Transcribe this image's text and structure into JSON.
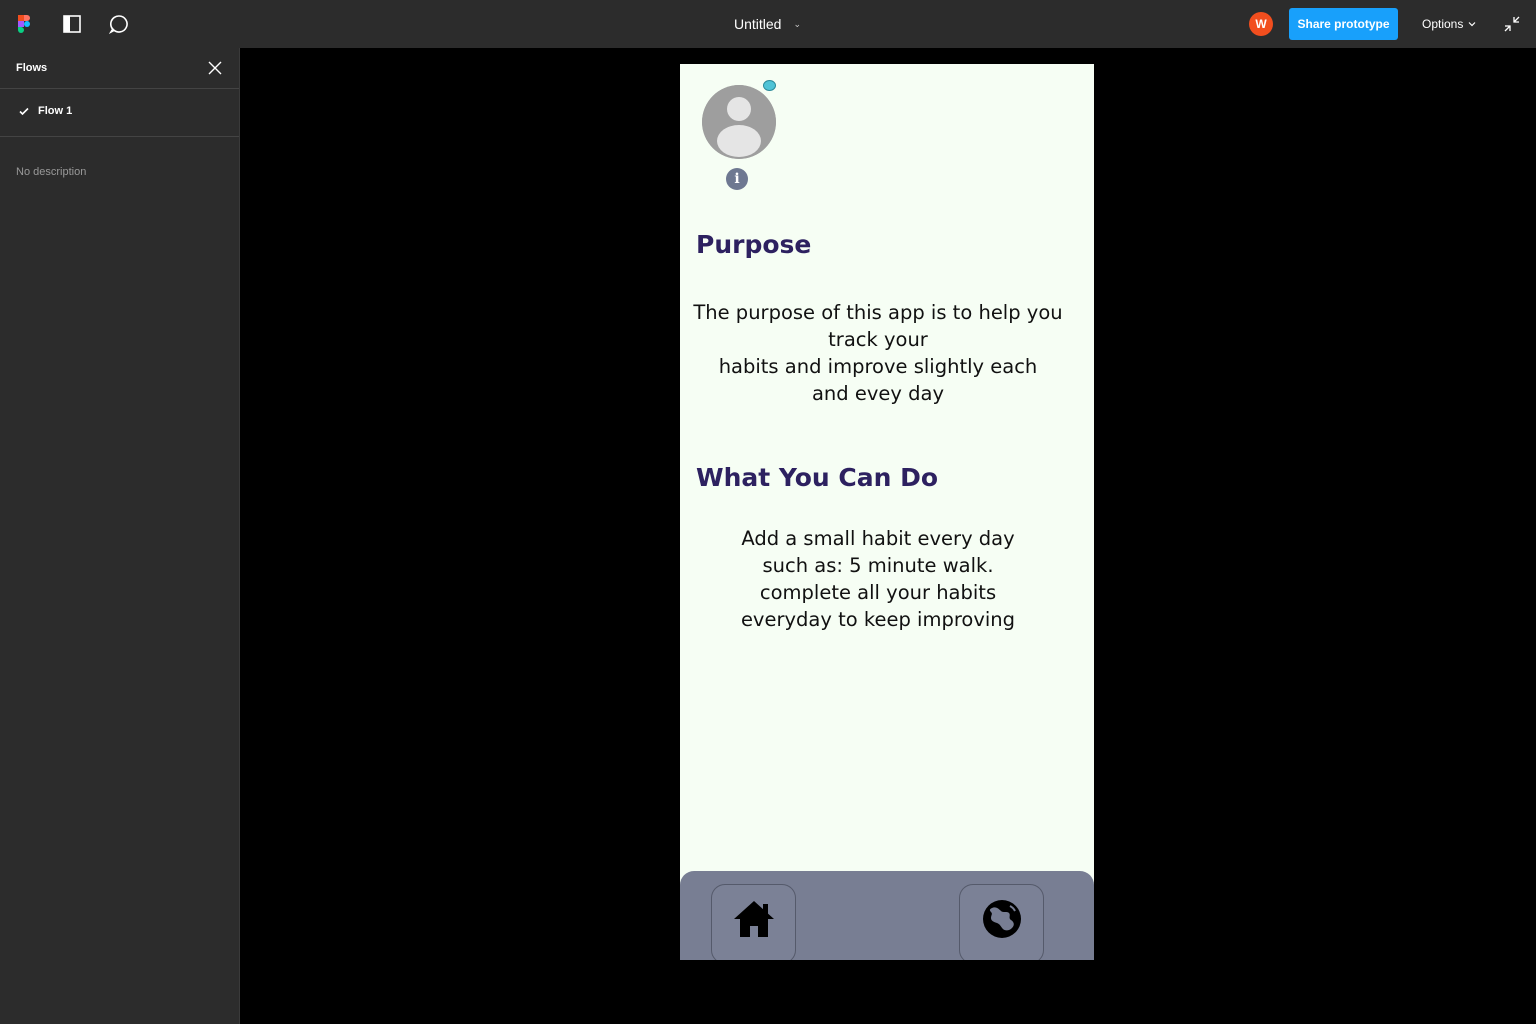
{
  "topbar": {
    "title": "Untitled",
    "avatar_initial": "W",
    "share_label": "Share prototype",
    "options_label": "Options",
    "brand_colors": {
      "share": "#18a0fb",
      "avatar": "#f24e1e"
    }
  },
  "sidebar": {
    "title": "Flows",
    "flows": [
      {
        "label": "Flow 1"
      }
    ],
    "description": "No description"
  },
  "app": {
    "purpose_heading": "Purpose",
    "purpose_lines": [
      "The purpose of this app is to help you",
      "track your",
      "habits and improve slightly each",
      "and evey day"
    ],
    "can_do_heading": "What You Can Do",
    "can_do_lines": [
      "Add a small habit every day",
      "such as: 5 minute walk.",
      "complete all your habits",
      "everyday to keep improving"
    ],
    "info_glyph": "i",
    "nav": [
      {
        "icon": "home-icon"
      },
      {
        "icon": "globe-icon"
      }
    ],
    "colors": {
      "heading": "#2d2160",
      "background": "#f6fef4",
      "navbar": "#787e93"
    }
  }
}
